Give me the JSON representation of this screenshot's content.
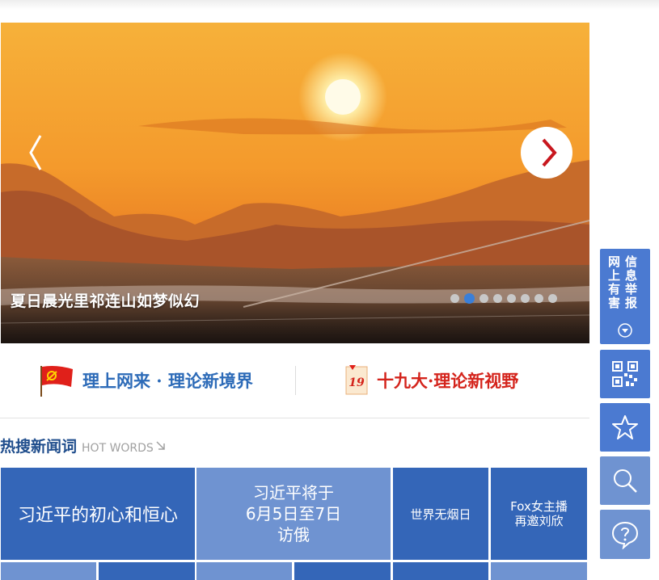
{
  "slider": {
    "caption": "夏日晨光里祁连山如梦似幻",
    "slide_count": 8,
    "active_index": 1
  },
  "banners": {
    "left_label": "理上网来 · 理论新境界",
    "right_label": "十九大·理论新视野",
    "right_badge": "19"
  },
  "hot_words": {
    "title_cn": "热搜新闻词",
    "title_en": "HOT WORDS",
    "tiles": [
      {
        "label": "习近平的初心和恒心"
      },
      {
        "label_lines": [
          "习近平将于",
          "6月5日至7日",
          "访俄"
        ]
      },
      {
        "label": "世界无烟日"
      },
      {
        "label_lines": [
          "Fox女主播",
          "再邀刘欣"
        ]
      }
    ]
  },
  "sidebar": {
    "report_col1": "网上有害",
    "report_col2": "信息举报"
  },
  "colors": {
    "accent_blue": "#3466b8",
    "light_blue": "#6f93d1",
    "red": "#d4241c"
  }
}
